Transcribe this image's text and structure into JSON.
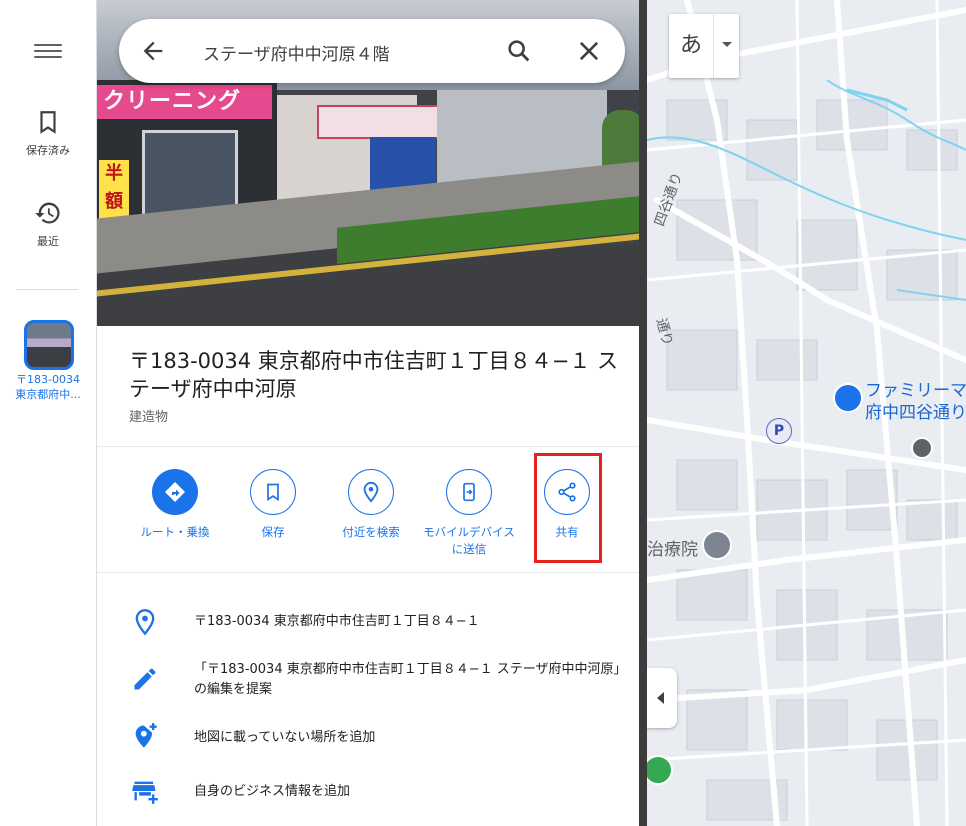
{
  "rail": {
    "saved_label": "保存済み",
    "recent_label": "最近",
    "recent_place_line1": "〒183-0034",
    "recent_place_line2": "東京都府中..."
  },
  "search": {
    "value": "ステーザ府中中河原４階"
  },
  "photo": {
    "sign_text": "クリーニング",
    "banner_text": "半額"
  },
  "place": {
    "title": "〒183-0034 東京都府中市住吉町１丁目８４−１ ステーザ府中中河原",
    "category": "建造物"
  },
  "actions": [
    {
      "label": "ルート・乗換"
    },
    {
      "label": "保存"
    },
    {
      "label": "付近を検索"
    },
    {
      "label": "モバイルデバイスに送信"
    },
    {
      "label": "共有"
    }
  ],
  "info": {
    "address": "〒183-0034 東京都府中市住吉町１丁目８４−１",
    "suggest_edit": "「〒183-0034 東京都府中市住吉町１丁目８４−１ ステーザ府中中河原」の編集を提案",
    "add_missing_place": "地図に載っていない場所を追加",
    "add_business": "自身のビジネス情報を追加"
  },
  "map": {
    "lang_char": "あ",
    "label_family": "ファミリーマ",
    "label_yotsuya": "府中四谷通り",
    "label_clinic": "治療院",
    "street1": "四谷通り",
    "street2": "通り",
    "parking": "P"
  },
  "colors": {
    "accent": "#1a73e8",
    "highlight": "#e3211d",
    "map_bg": "#e9ecf1"
  }
}
